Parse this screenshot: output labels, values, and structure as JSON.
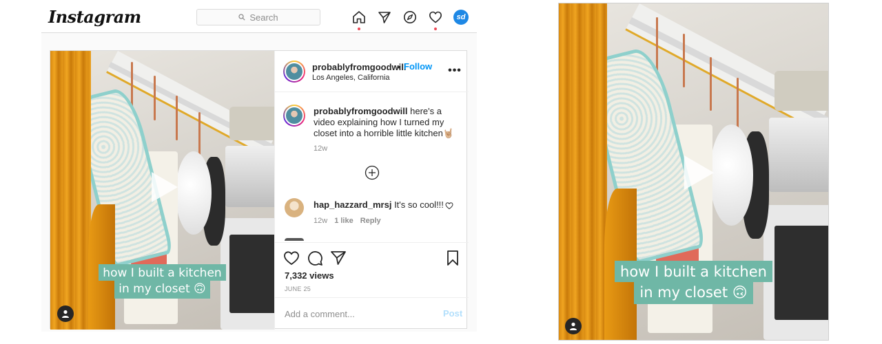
{
  "brand": {
    "logo_text": "Instagram"
  },
  "search": {
    "placeholder": "Search"
  },
  "nav": {
    "icons": [
      "home-icon",
      "direct-icon",
      "explore-icon",
      "activity-icon"
    ],
    "profile_initials": "sd"
  },
  "post": {
    "username": "probablyfromgoodwill",
    "follow_separator": "•",
    "follow_label": "Follow",
    "location": "Los Angeles, California",
    "more_label": "•••",
    "caption": {
      "username": "probablyfromgoodwill",
      "text": "here's a video explaining how I turned my closet into a horrible little kitchen🤘🏼",
      "time": "12w"
    },
    "comments": [
      {
        "username": "hap_hazzard_mrsj",
        "text": "It's so cool!!!",
        "time": "12w",
        "likes": "1 like",
        "reply": "Reply"
      }
    ],
    "views": "7,332 views",
    "date": "JUNE 25",
    "add_comment": {
      "placeholder": "Add a comment...",
      "post_label": "Post"
    }
  },
  "video": {
    "caption_line1": "how I built a kitchen",
    "caption_line2": "in my closet 🙃"
  },
  "colors": {
    "accent": "#0095f6",
    "post_disabled": "#b2dffc",
    "notification": "#ed4956",
    "caption_bg": "#6fb7a6",
    "profile_badge": "#1e88e5"
  }
}
